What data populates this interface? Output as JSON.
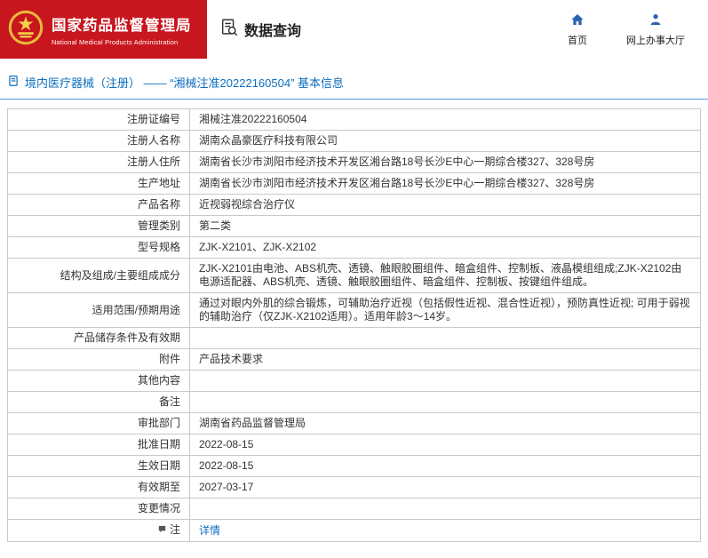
{
  "header": {
    "agency_cn": "国家药品监督管理局",
    "agency_en": "National Medical Products Administration",
    "section_title": "数据查询",
    "nav": [
      {
        "label": "首页",
        "icon": "home-icon"
      },
      {
        "label": "网上办事大厅",
        "icon": "person-icon"
      }
    ]
  },
  "breadcrumb": {
    "text": "境内医疗器械（注册） —— “湘械注准20222160504” 基本信息",
    "icon": "document-icon"
  },
  "colors": {
    "brand_red": "#c8161e",
    "link_blue": "#0d6fbe",
    "table_border": "#c9c9c9",
    "emblem_gold": "#f0c84c"
  },
  "table": {
    "rows": [
      {
        "label": "注册证编号",
        "value": "湘械注准20222160504"
      },
      {
        "label": "注册人名称",
        "value": "湖南众晶豪医疗科技有限公司"
      },
      {
        "label": "注册人住所",
        "value": "湖南省长沙市浏阳市经济技术开发区湘台路18号长沙E中心一期综合楼327、328号房"
      },
      {
        "label": "生产地址",
        "value": "湖南省长沙市浏阳市经济技术开发区湘台路18号长沙E中心一期综合楼327、328号房"
      },
      {
        "label": "产品名称",
        "value": "近视弱视综合治疗仪"
      },
      {
        "label": "管理类别",
        "value": "第二类"
      },
      {
        "label": "型号规格",
        "value": "ZJK-X2101、ZJK-X2102"
      },
      {
        "label": "结构及组成/主要组成成分",
        "value": "ZJK-X2101由电池、ABS机壳、透镜、触眼胶圈组件、暗盒组件、控制板、液晶模组组成;ZJK-X2102由电源适配器、ABS机壳、透镜、触眼胶圈组件、暗盒组件、控制板、按键组件组成。"
      },
      {
        "label": "适用范围/预期用途",
        "value": "通过对眼内外肌的综合锻炼，可辅助治疗近视（包括假性近视、混合性近视），预防真性近视; 可用于弱视的辅助治疗（仅ZJK-X2102适用）。适用年龄3～14岁。"
      },
      {
        "label": "产品储存条件及有效期",
        "value": ""
      },
      {
        "label": "附件",
        "value": "产品技术要求"
      },
      {
        "label": "其他内容",
        "value": ""
      },
      {
        "label": "备注",
        "value": ""
      },
      {
        "label": "审批部门",
        "value": "湖南省药品监督管理局"
      },
      {
        "label": "批准日期",
        "value": "2022-08-15"
      },
      {
        "label": "生效日期",
        "value": "2022-08-15"
      },
      {
        "label": "有效期至",
        "value": "2027-03-17"
      },
      {
        "label": "变更情况",
        "value": ""
      },
      {
        "label": "注",
        "value": "详情",
        "value_is_link": true,
        "label_icon": "note-icon"
      }
    ]
  }
}
